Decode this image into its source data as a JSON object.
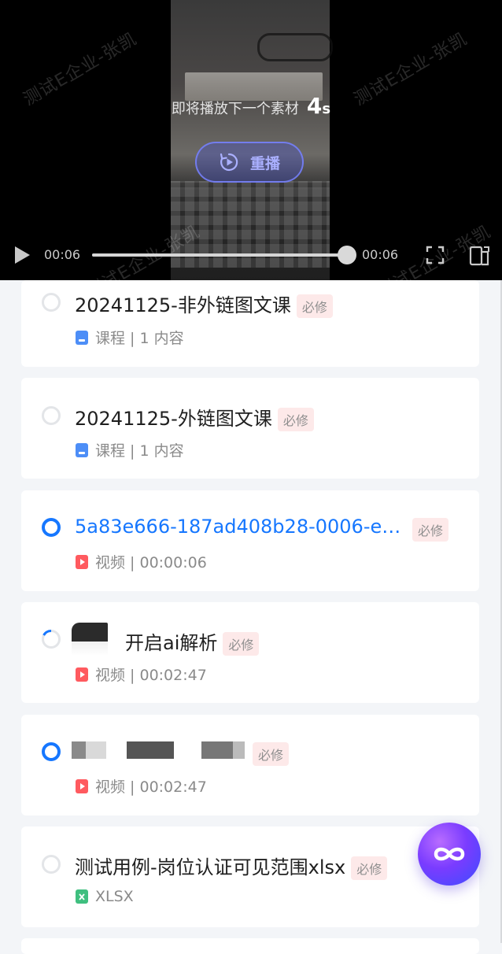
{
  "player": {
    "watermark": "测试E企业-张凯",
    "next_tip_text": "即将播放下一个素材",
    "countdown": "4",
    "countdown_unit": "s",
    "replay_label": "重播",
    "time_current": "00:06",
    "time_total": "00:06",
    "progress": 1.0
  },
  "list": {
    "items": [
      {
        "status": "todo",
        "title": "20241125-非外链图文课",
        "tag": "必修",
        "meta_icon": "course-book-icon",
        "meta": "课程 | 1 内容"
      },
      {
        "status": "todo",
        "title": "20241125-外链图文课",
        "tag": "必修",
        "meta_icon": "course-book-icon",
        "meta": "课程 | 1 内容"
      },
      {
        "status": "active",
        "title": "5a83e666-187ad408b28-0006-e…",
        "tag": "必修",
        "meta_icon": "video-file-icon",
        "meta": "视频 | 00:00:06"
      },
      {
        "status": "loading",
        "title": "开启ai解析",
        "tag": "必修",
        "meta_icon": "video-file-icon",
        "meta": "视频 | 00:02:47"
      },
      {
        "status": "active",
        "title": "",
        "tag": "必修",
        "meta_icon": "video-file-icon",
        "meta": "视频 | 00:02:47"
      },
      {
        "status": "todo",
        "title": "测试用例-岗位认证可见范围xlsx",
        "tag": "必修",
        "meta_icon": "xlsx-file-icon",
        "meta": "XLSX"
      }
    ]
  },
  "colors": {
    "accent": "#1677ff",
    "tag_bg": "#fde9e9",
    "video_icon": "#ff5a5f",
    "course_icon": "#4d8ef7",
    "xlsx_icon": "#3fbf7f"
  }
}
